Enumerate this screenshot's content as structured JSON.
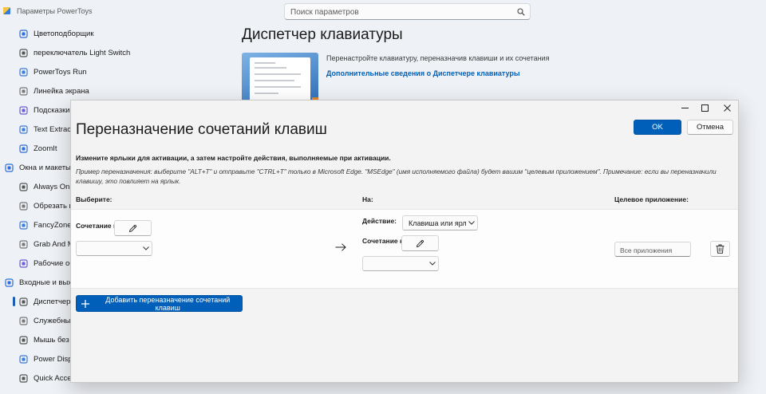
{
  "app": {
    "title": "Параметры PowerToys",
    "search_placeholder": "Поиск параметров",
    "page_title": "Диспетчер клавиатуры",
    "page_description": "Перенастройте клавиатуру, переназначив клавиши и их сочетания",
    "learn_more_link": "Дополнительные сведения о Диспетчере клавиатуры"
  },
  "sidebar": {
    "items": [
      {
        "label": "Цветоподборщик",
        "icon": "color-picker-icon"
      },
      {
        "label": "переключатель Light Switch",
        "icon": "light-switch-icon"
      },
      {
        "label": "PowerToys Run",
        "icon": "run-icon"
      },
      {
        "label": "Линейка экрана",
        "icon": "ruler-icon"
      },
      {
        "label": "Подсказки к",
        "icon": "hints-icon"
      },
      {
        "label": "Text Extracto",
        "icon": "text-extractor-icon"
      },
      {
        "label": "ZoomIt",
        "icon": "zoomit-icon"
      },
      {
        "label": "Окна и макеты",
        "icon": "windows-layouts-icon",
        "group": true
      },
      {
        "label": "Always On T",
        "icon": "always-on-top-icon"
      },
      {
        "label": "Обрезать и",
        "icon": "crop-icon"
      },
      {
        "label": "FancyZones",
        "icon": "fancyzones-icon"
      },
      {
        "label": "Grab And M",
        "icon": "grab-move-icon"
      },
      {
        "label": "Рабочие об",
        "icon": "workspaces-icon"
      },
      {
        "label": "Входные и выход",
        "icon": "input-output-icon",
        "group": true
      },
      {
        "label": "Диспетчер к",
        "icon": "keyboard-icon",
        "selected": true
      },
      {
        "label": "Служебные",
        "icon": "mouse-utilities-icon"
      },
      {
        "label": "Мышь без г",
        "icon": "mouse-icon"
      },
      {
        "label": "Power Displa",
        "icon": "display-icon"
      },
      {
        "label": "Quick Accen",
        "icon": "accent-icon"
      }
    ]
  },
  "dialog": {
    "title": "Переназначение сочетаний клавиш",
    "ok_label": "OK",
    "cancel_label": "Отмена",
    "instruction": "Измените ярлыки для активации, а затем настройте действия, выполняемые при активации.",
    "example": "Пример переназначения: выберите \"ALT+T\" и отправьте \"CTRL+T\" только в Microsoft Edge. \"MSEdge\" (имя исполняемого файла) будет вашим \"целевым приложением\". Примечание: если вы переназначили клавишу, это повлияет на ярлык.",
    "col_select": "Выберите:",
    "col_to": "На:",
    "col_target_app": "Целевое приложение:",
    "row": {
      "shortcut_label": "Сочетание к",
      "action_label": "Действие:",
      "action_value": "Клавиша или ярл",
      "shortcut_label_to": "Сочетание к",
      "target_app_placeholder": "Все приложения"
    },
    "add_label": "Добавить переназначение сочетаний клавиш"
  }
}
